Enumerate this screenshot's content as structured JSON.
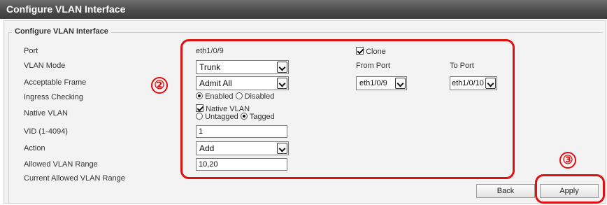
{
  "window": {
    "title": "Configure VLAN Interface"
  },
  "form": {
    "legend": "Configure VLAN Interface",
    "labels": {
      "port": "Port",
      "vlan_mode": "VLAN Mode",
      "acceptable_frame": "Acceptable Frame",
      "ingress_checking": "Ingress Checking",
      "native_vlan": "Native VLAN",
      "vid": "VID (1-4094)",
      "action": "Action",
      "allowed_vlan_range": "Allowed VLAN Range",
      "current_allowed_vlan_range": "Current Allowed VLAN Range"
    },
    "port_value": "eth1/0/9",
    "vlan_mode": "Trunk",
    "acceptable_frame": "Admit All",
    "ingress_enabled": "Enabled",
    "ingress_disabled": "Disabled",
    "native_vlan_checkbox": "Native VLAN",
    "untagged": "Untagged",
    "tagged": "Tagged",
    "vid_value": "1",
    "action": "Add",
    "allowed_vlan_range_value": "10,20",
    "clone_label": "Clone",
    "from_port_label": "From Port",
    "to_port_label": "To Port",
    "from_port": "eth1/0/9",
    "to_port": "eth1/0/10"
  },
  "buttons": {
    "back": "Back",
    "apply": "Apply"
  },
  "annotations": {
    "num2": "②",
    "num3": "③",
    "color": "#e01010"
  }
}
